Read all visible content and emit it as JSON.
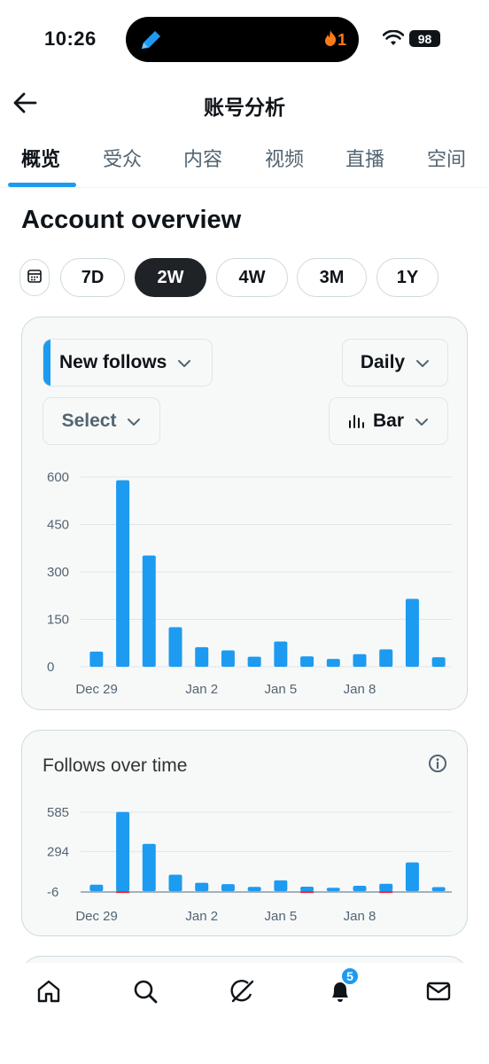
{
  "status_bar": {
    "time": "10:26",
    "activity_count": "1",
    "battery": "98"
  },
  "header": {
    "title": "账号分析"
  },
  "tabs": [
    {
      "label": "概览",
      "active": true
    },
    {
      "label": "受众",
      "active": false
    },
    {
      "label": "内容",
      "active": false
    },
    {
      "label": "视频",
      "active": false
    },
    {
      "label": "直播",
      "active": false
    },
    {
      "label": "空间",
      "active": false
    }
  ],
  "section": {
    "title": "Account overview"
  },
  "ranges": [
    {
      "label": "7D",
      "active": false
    },
    {
      "label": "2W",
      "active": true
    },
    {
      "label": "4W",
      "active": false
    },
    {
      "label": "3M",
      "active": false
    },
    {
      "label": "1Y",
      "active": false
    }
  ],
  "controls": {
    "metric": "New follows",
    "period": "Daily",
    "select": "Select",
    "chart_type": "Bar"
  },
  "follows_card": {
    "title": "Follows over time"
  },
  "nav": {
    "notification_count": "5"
  },
  "colors": {
    "accent": "#1d9bf0",
    "bar": "#1d9bf0",
    "negative": "#f4212e"
  },
  "chart_data": [
    {
      "type": "bar",
      "title": "",
      "xlabel": "",
      "ylabel": "",
      "x_ticks": [
        "Dec 29",
        "Jan 2",
        "Jan 5",
        "Jan 8"
      ],
      "x_tick_index": [
        0,
        4,
        7,
        10
      ],
      "y_ticks": [
        0,
        150,
        300,
        450,
        600
      ],
      "ylim": [
        0,
        600
      ],
      "grid": true,
      "values": [
        48,
        590,
        352,
        125,
        62,
        52,
        32,
        80,
        33,
        25,
        40,
        55,
        215,
        30
      ]
    },
    {
      "type": "bar",
      "title": "Follows over time",
      "xlabel": "",
      "ylabel": "",
      "x_ticks": [
        "Dec 29",
        "Jan 2",
        "Jan 5",
        "Jan 8"
      ],
      "x_tick_index": [
        0,
        4,
        7,
        10
      ],
      "y_ticks": [
        -6,
        294,
        585
      ],
      "ylim": [
        -6,
        585
      ],
      "grid": true,
      "series": [
        {
          "name": "",
          "values": [
            48,
            587,
            350,
            122,
            62,
            52,
            32,
            80,
            33,
            25,
            40,
            55,
            213,
            30
          ]
        },
        {
          "name": "",
          "values": [
            0,
            -3,
            0,
            0,
            0,
            0,
            0,
            0,
            -2,
            0,
            0,
            -2,
            0,
            0
          ]
        }
      ]
    }
  ]
}
